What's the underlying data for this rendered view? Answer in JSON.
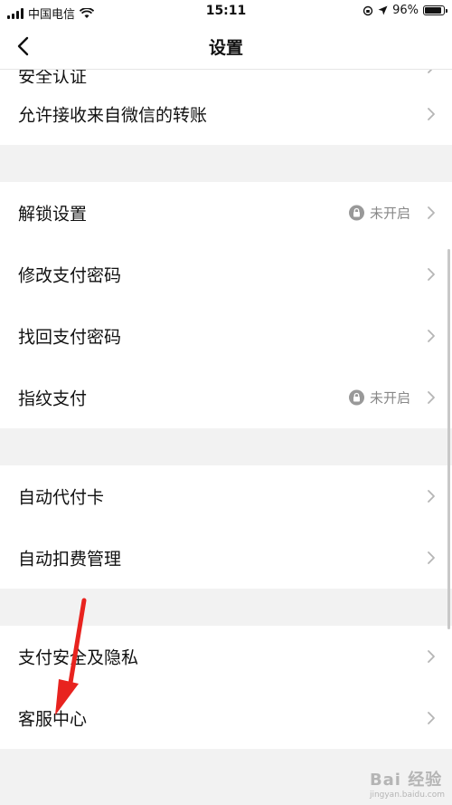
{
  "status_bar": {
    "carrier": "中国电信",
    "time": "15:11",
    "battery": "96%",
    "battery_level": 0.96
  },
  "nav": {
    "title": "设置",
    "back_icon": "chevron-left-icon"
  },
  "sections": [
    {
      "rows": [
        {
          "label": "安全认证",
          "partial": true
        },
        {
          "label": "允许接收来自微信的转账"
        }
      ]
    },
    {
      "rows": [
        {
          "label": "解锁设置",
          "status": "未开启",
          "status_icon": "lock-icon"
        },
        {
          "label": "修改支付密码"
        },
        {
          "label": "找回支付密码"
        },
        {
          "label": "指纹支付",
          "status": "未开启",
          "status_icon": "lock-icon"
        }
      ]
    },
    {
      "rows": [
        {
          "label": "自动代付卡"
        },
        {
          "label": "自动扣费管理"
        }
      ]
    },
    {
      "rows": [
        {
          "label": "支付安全及隐私"
        },
        {
          "label": "客服中心"
        }
      ]
    }
  ],
  "watermark": {
    "text": "Bai 经验",
    "sub": "jingyan.baidu.com"
  },
  "colors": {
    "annotation_arrow": "#e8231f",
    "chevron": "#b5b5b5",
    "status_text": "#888888"
  }
}
